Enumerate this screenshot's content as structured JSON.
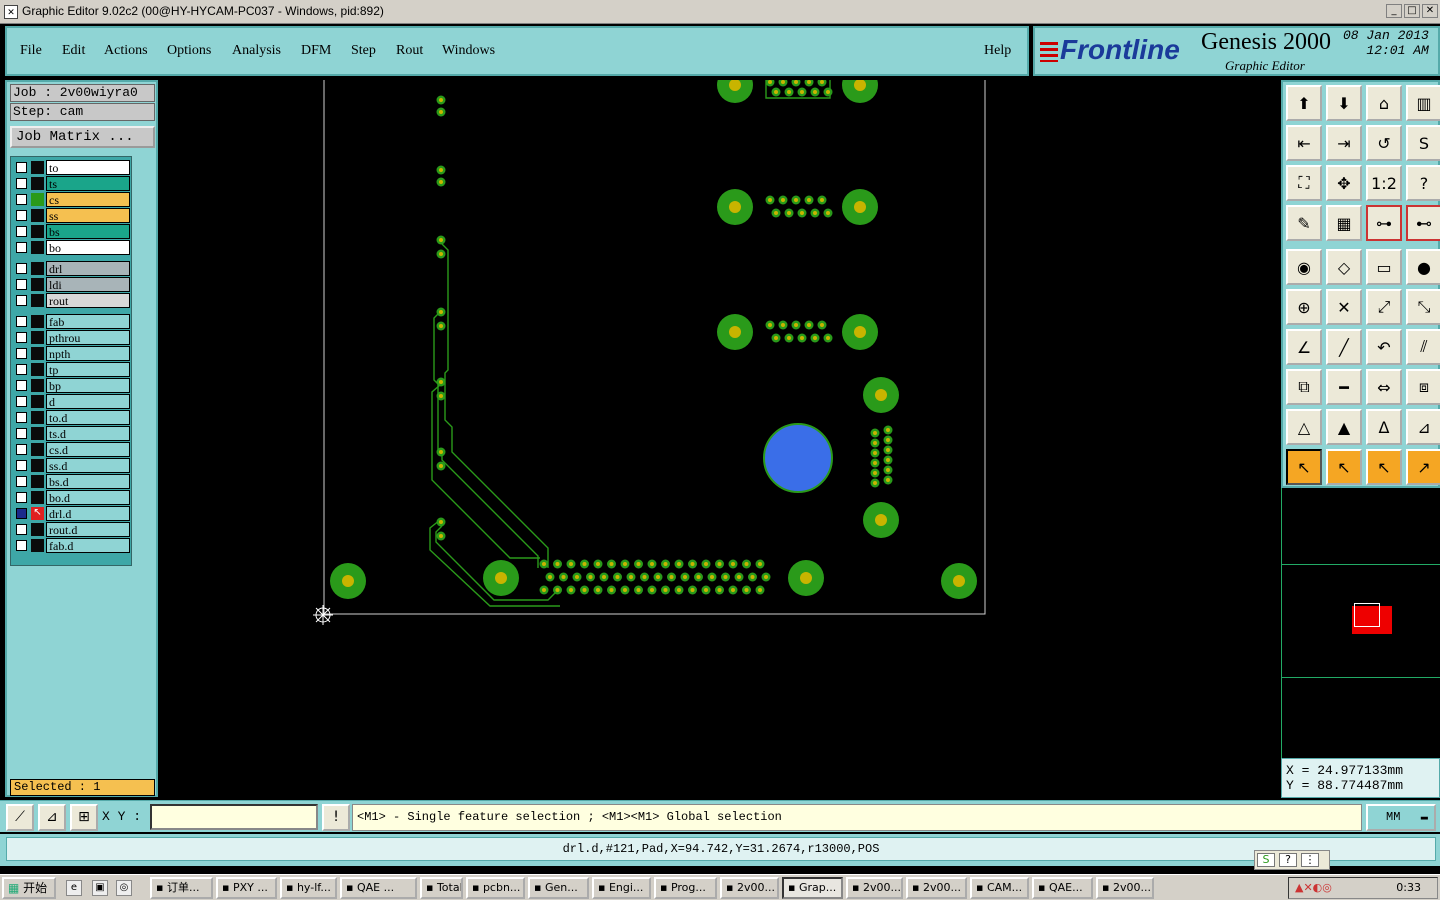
{
  "title_bar": {
    "text": "Graphic Editor 9.02c2 (00@HY-HYCAM-PC037 - Windows, pid:892)"
  },
  "menu": {
    "file": "File",
    "edit": "Edit",
    "actions": "Actions",
    "options": "Options",
    "analysis": "Analysis",
    "dfm": "DFM",
    "step": "Step",
    "rout": "Rout",
    "windows": "Windows",
    "help": "Help"
  },
  "logo": {
    "brand": "Frontline",
    "product": "Genesis 2000",
    "subtitle": "Graphic Editor",
    "date": "08 Jan 2013",
    "time": "12:01 AM"
  },
  "job": {
    "job_label": "Job : 2v00wiyra0",
    "step_label": "Step: cam",
    "matrix_button": "Job Matrix ..."
  },
  "layers": [
    {
      "name": "to",
      "color": "#ffffff",
      "checked": false
    },
    {
      "name": "ts",
      "color": "#1aa58a",
      "checked": false
    },
    {
      "name": "cs",
      "color": "#f5c050",
      "checked": false
    },
    {
      "name": "ss",
      "color": "#f5c050",
      "checked": false
    },
    {
      "name": "bs",
      "color": "#1aa58a",
      "checked": false
    },
    {
      "name": "bo",
      "color": "#ffffff",
      "checked": false
    },
    {
      "name": "drl",
      "color": "#a8b4b8",
      "checked": false
    },
    {
      "name": "ldi",
      "color": "#a8b4b8",
      "checked": false
    },
    {
      "name": "rout",
      "color": "#d8d8d8",
      "checked": false
    },
    {
      "name": "fab",
      "color": "#8fd4d4",
      "checked": false
    },
    {
      "name": "pthrou",
      "color": "#8fd4d4",
      "checked": false
    },
    {
      "name": "npth",
      "color": "#8fd4d4",
      "checked": false
    },
    {
      "name": "tp",
      "color": "#8fd4d4",
      "checked": false
    },
    {
      "name": "bp",
      "color": "#8fd4d4",
      "checked": false
    },
    {
      "name": "d",
      "color": "#8fd4d4",
      "checked": false
    },
    {
      "name": "to.d",
      "color": "#8fd4d4",
      "checked": false
    },
    {
      "name": "ts.d",
      "color": "#8fd4d4",
      "checked": false
    },
    {
      "name": "cs.d",
      "color": "#8fd4d4",
      "checked": false
    },
    {
      "name": "ss.d",
      "color": "#8fd4d4",
      "checked": false
    },
    {
      "name": "bs.d",
      "color": "#8fd4d4",
      "checked": false
    },
    {
      "name": "bo.d",
      "color": "#8fd4d4",
      "checked": false
    },
    {
      "name": "drl.d",
      "color": "#8fd4d4",
      "checked": true,
      "work": true
    },
    {
      "name": "rout.d",
      "color": "#8fd4d4",
      "checked": false
    },
    {
      "name": "fab.d",
      "color": "#8fd4d4",
      "checked": false
    }
  ],
  "selected": {
    "text": "Selected : 1"
  },
  "coords": {
    "x": "X = 24.977133mm",
    "y": "Y = 88.774487mm"
  },
  "bottom": {
    "xy_label": "X Y :",
    "xy_value": "",
    "prompt": "<M1> - Single feature selection ; <M1><M1> Global selection",
    "unit": "MM"
  },
  "status": {
    "text": "drl.d,#121,Pad,X=94.742,Y=31.2674,r13000,POS"
  },
  "taskbar": {
    "start": "开始",
    "tasks": [
      "订单...",
      "PXY ...",
      "hy-lf...",
      "QAE ...",
      "Total...",
      "pcbn...",
      "Gen...",
      "Engi...",
      "Prog...",
      "2v00...",
      "Grap...",
      "2v00...",
      "2v00...",
      "CAM...",
      "QAE...",
      "2v00..."
    ],
    "clock": "0:33"
  },
  "colors": {
    "panel": "#8fd4d4",
    "pad": "#2a9a1a",
    "hole": "#c8b400",
    "selected_pad": "#3a6ee8",
    "trace": "#2a9a1a"
  }
}
